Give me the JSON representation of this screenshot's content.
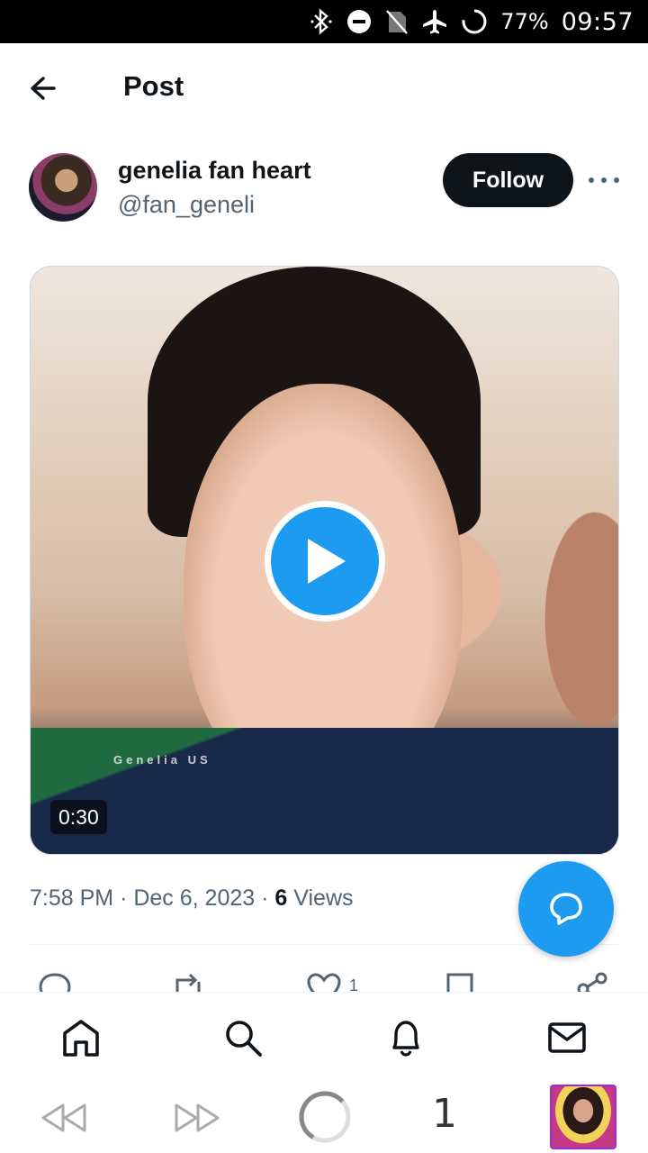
{
  "status_bar": {
    "battery": "77%",
    "time": "09:57",
    "icons": [
      "bluetooth-icon",
      "dnd-icon",
      "no-sim-icon",
      "airplane-icon",
      "battery-ring-icon"
    ]
  },
  "header": {
    "title": "Post",
    "back_icon": "arrow-left-icon"
  },
  "author": {
    "name": "genelia fan heart",
    "handle": "@fan_geneli",
    "follow_label": "Follow",
    "more_icon": "more-horizontal-icon"
  },
  "media": {
    "duration": "0:30",
    "watermark": "Genelia US",
    "play_icon": "play-icon"
  },
  "meta": {
    "time": "7:58 PM",
    "separator": "·",
    "date": "Dec 6, 2023",
    "views_count": "6",
    "views_label": "Views"
  },
  "actions": {
    "reply_icon": "reply-icon",
    "repost_icon": "repost-icon",
    "like_icon": "heart-icon",
    "like_count": "1",
    "bookmark_icon": "bookmark-icon",
    "share_icon": "share-icon"
  },
  "fab": {
    "icon": "chat-bubble-icon"
  },
  "bottom_nav": {
    "items": [
      "home-icon",
      "search-icon",
      "bell-icon",
      "mail-icon"
    ]
  },
  "system_bar": {
    "tab_count": "1",
    "icons": [
      "rewind-icon",
      "fast-forward-icon",
      "loading-ring-icon",
      "tab-thumbnail"
    ]
  },
  "colors": {
    "accent": "#1d9bf0",
    "text": "#0f1419",
    "secondary": "#536471",
    "follow_bg": "#0f1419"
  }
}
